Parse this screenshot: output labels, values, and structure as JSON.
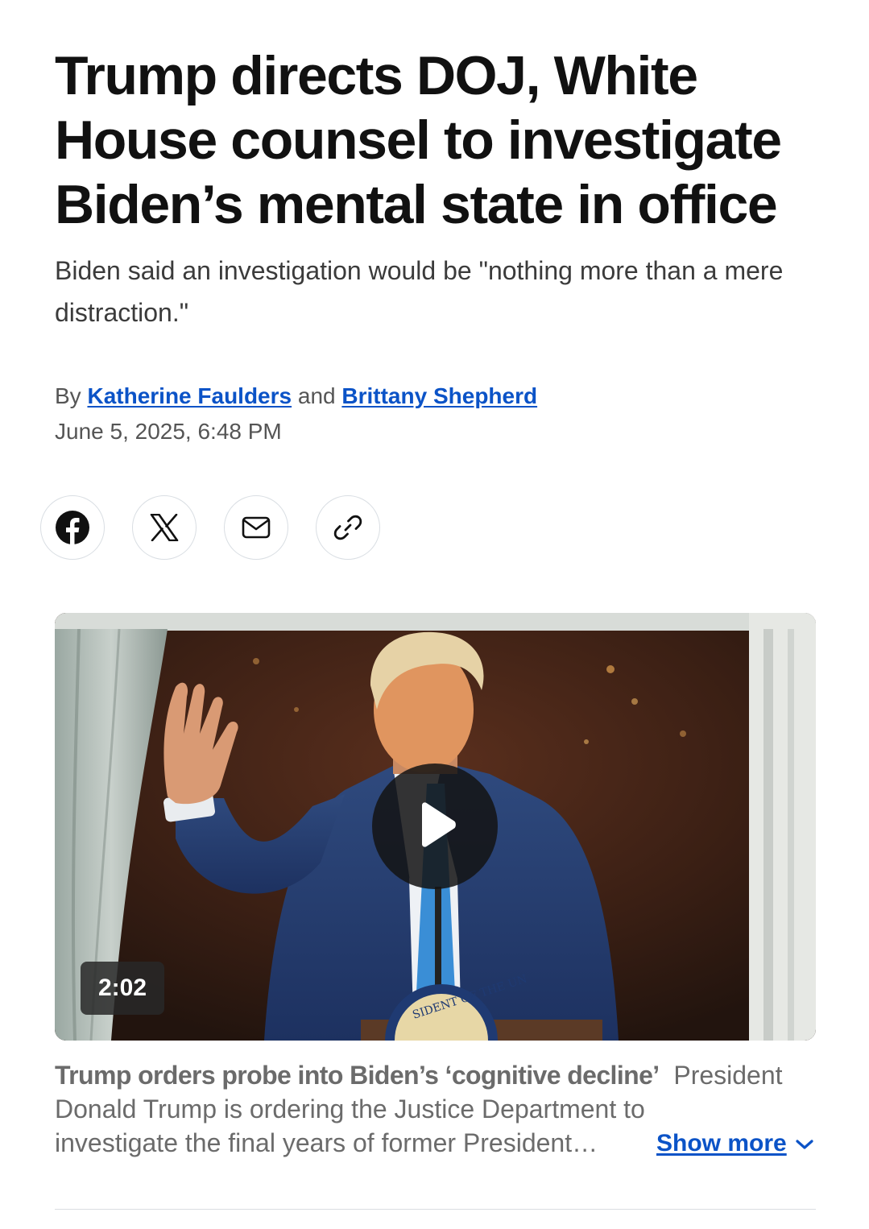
{
  "article": {
    "headline": "Trump directs DOJ, White House counsel to investigate Biden’s mental state in office",
    "subheadline": "Biden said an investigation would be \"nothing more than a mere distraction.\"",
    "byline": {
      "prefix": "By",
      "author_1": "Katherine Faulders",
      "conjunction": "and",
      "author_2": "Brittany Shepherd",
      "link_color": "#0b53c7"
    },
    "date": "June 5, 2025, 6:48 PM"
  },
  "share": {
    "buttons": [
      {
        "icon": "facebook-icon"
      },
      {
        "icon": "x-icon"
      },
      {
        "icon": "mail-icon"
      },
      {
        "icon": "link-icon"
      }
    ]
  },
  "video": {
    "duration": "2:02",
    "play_icon": "play-icon",
    "caption_title": "Trump orders probe into Biden’s ‘cognitive decline’",
    "caption_line_1_rest": "President",
    "caption_line_2": "Donald Trump is ordering the Justice Department to",
    "caption_line_3": "investigate the final years of former President…",
    "show_more": "Show more",
    "seal_text": "SIDENT OF THE UN"
  },
  "colors": {
    "link": "#0b53c7",
    "headline": "#111111",
    "muted": "#6b6b6b",
    "divider": "#dadde1"
  }
}
